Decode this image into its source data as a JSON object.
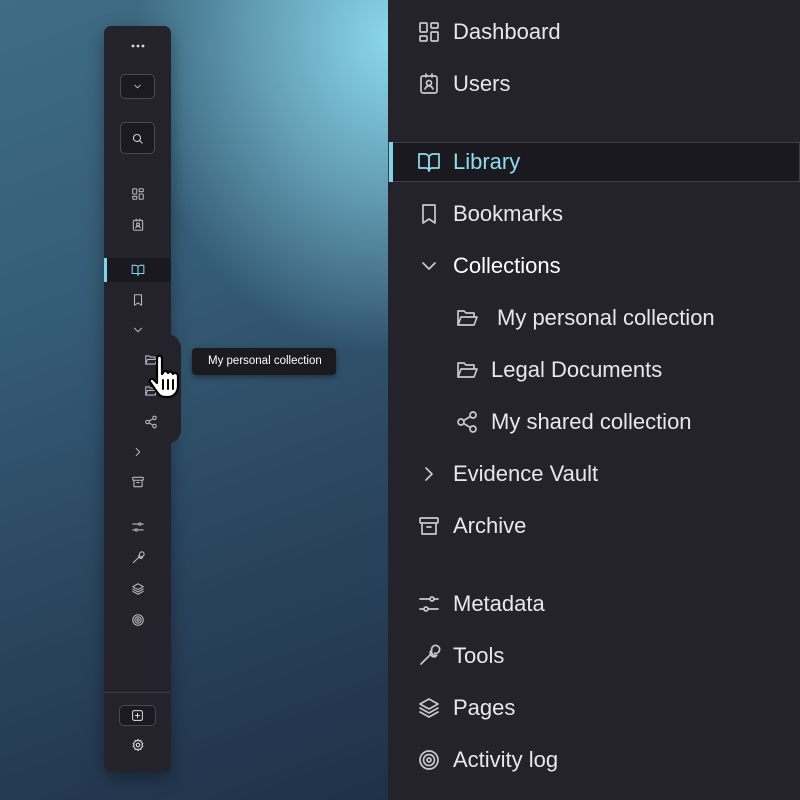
{
  "tooltip": "My personal collection",
  "nav": {
    "dashboard": "Dashboard",
    "users": "Users",
    "library": "Library",
    "bookmarks": "Bookmarks",
    "collections": "Collections",
    "personal_collection": "My personal collection",
    "legal_documents": "Legal Documents",
    "shared_collection": "My shared collection",
    "evidence_vault": "Evidence Vault",
    "archive": "Archive",
    "metadata": "Metadata",
    "tools": "Tools",
    "pages": "Pages",
    "activity_log": "Activity log"
  },
  "active_item": "Library",
  "colors": {
    "accent": "#7fd4ea",
    "sidebar_bg": "#24232b",
    "text": "#e8e7ee"
  }
}
